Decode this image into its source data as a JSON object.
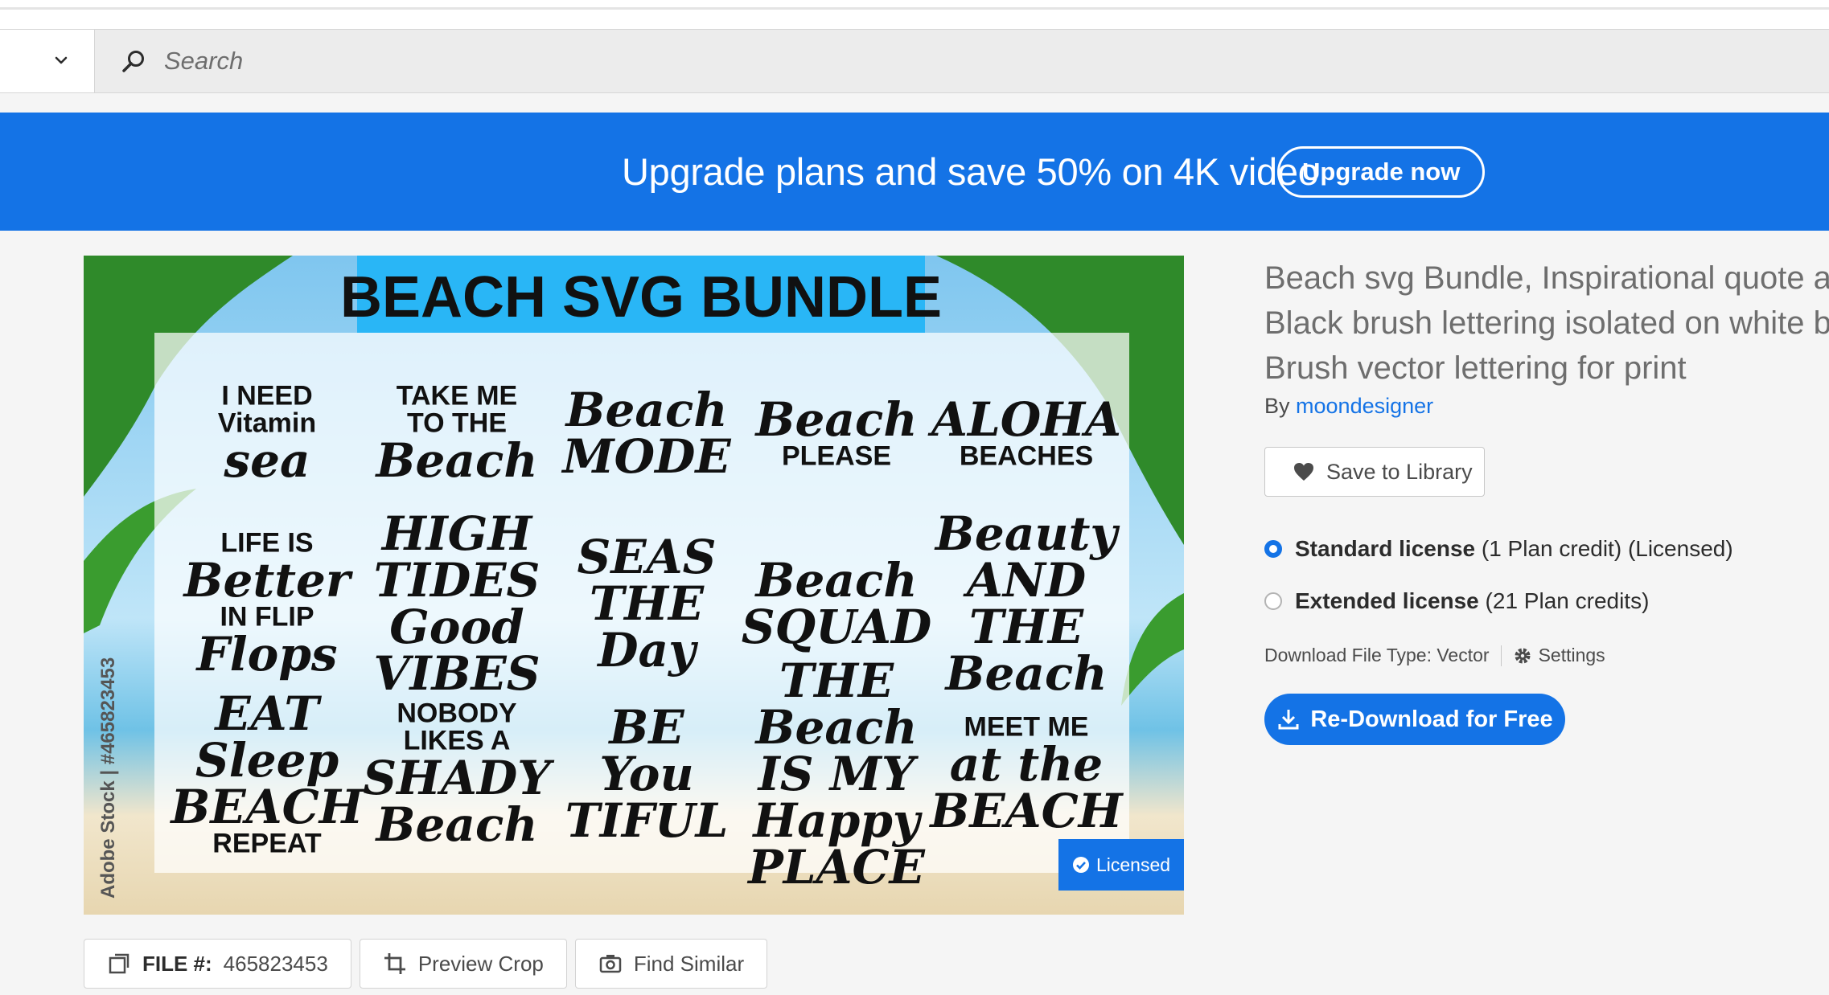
{
  "search": {
    "placeholder": "Search"
  },
  "banner": {
    "text": "Upgrade plans and save 50% on 4K video",
    "button_label": "Upgrade now"
  },
  "preview": {
    "header": "BEACH SVG BUNDLE",
    "watermark": "Adobe Stock | #465823453",
    "licensed_label": "Licensed",
    "designs": [
      [
        "I NEED",
        "Vitamin",
        "sea"
      ],
      [
        "TAKE ME",
        "TO THE",
        "Beach"
      ],
      [
        "Beach",
        "MODE"
      ],
      [
        "Beach",
        "PLEASE"
      ],
      [
        "ALOHA",
        "BEACHES"
      ],
      [
        "LIFE IS",
        "Better",
        "IN FLIP",
        "Flops"
      ],
      [
        "HIGH",
        "TIDES",
        "Good",
        "VIBES"
      ],
      [
        "SEAS",
        "THE",
        "Day"
      ],
      [
        "Beach",
        "SQUAD"
      ],
      [
        "Beauty",
        "AND",
        "THE",
        "Beach"
      ],
      [
        "EAT",
        "Sleep",
        "BEACH",
        "REPEAT"
      ],
      [
        "NOBODY",
        "LIKES A",
        "SHADY",
        "Beach"
      ],
      [
        "BE",
        "You",
        "TIFUL"
      ],
      [
        "THE",
        "Beach",
        "IS MY",
        "Happy",
        "PLACE"
      ],
      [
        "MEET ME",
        "at the",
        "BEACH"
      ]
    ]
  },
  "file_toolbar": {
    "file_label": "FILE #:",
    "file_number": "465823453",
    "preview_crop": "Preview Crop",
    "find_similar": "Find Similar"
  },
  "asset": {
    "title_lines": [
      "Beach svg Bundle, Inspirational quote abo",
      "Black brush lettering isolated on white ba",
      "Brush vector lettering for print"
    ],
    "by_label": "By",
    "author": "moondesigner",
    "save_label": "Save to Library"
  },
  "licenses": [
    {
      "name": "Standard license",
      "detail": "(1 Plan credit) (Licensed)",
      "selected": true
    },
    {
      "name": "Extended license",
      "detail": "(21 Plan credits)",
      "selected": false
    }
  ],
  "download": {
    "file_type": "Download File Type: Vector",
    "settings_label": "Settings",
    "button_label": "Re-Download for Free"
  },
  "colors": {
    "accent": "#1473e6",
    "header_bg": "#29b6f6"
  },
  "icons": {
    "search": "search-icon",
    "chevron": "chevron-down-icon",
    "heart": "heart-icon",
    "gear": "gear-icon",
    "download": "download-icon",
    "crop": "crop-icon",
    "camera": "camera-icon",
    "file": "file-icon",
    "check": "check-circle-icon"
  }
}
